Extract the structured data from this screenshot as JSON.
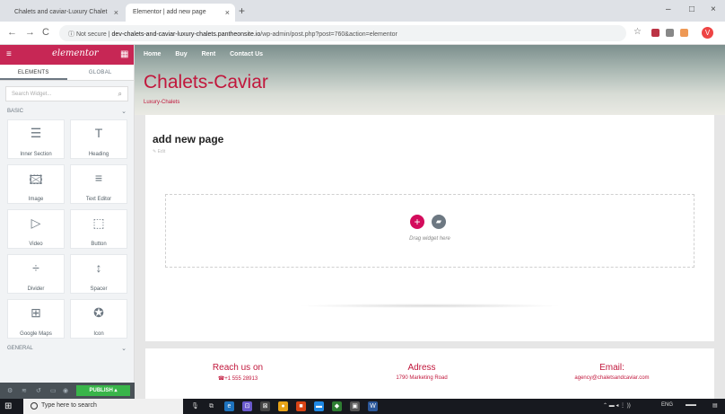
{
  "browser": {
    "tabs": [
      {
        "title": "Chalets and caviar-Luxury Chalet",
        "active": false
      },
      {
        "title": "Elementor | add new page",
        "active": true
      }
    ],
    "new_tab": "+",
    "minimize": "–",
    "maximize": "□",
    "close": "×",
    "back": "←",
    "forward": "→",
    "reload": "C",
    "security": "Not secure",
    "url_domain": "dev-chalets-and-caviar-luxury-chalets.pantheonsite.io",
    "url_path": "/wp-admin/post.php?post=760&action=elementor",
    "star": "☆",
    "profile_initial": "V"
  },
  "panel": {
    "logo": "elementor",
    "tabs": [
      "ELEMENTS",
      "GLOBAL"
    ],
    "search_placeholder": "Search Widget...",
    "category_basic": "BASIC",
    "category_general": "GENERAL",
    "widgets": [
      {
        "icon": "inner-section-icon",
        "label": "Inner Section",
        "glyph": "☰"
      },
      {
        "icon": "heading-icon",
        "label": "Heading",
        "glyph": "T"
      },
      {
        "icon": "image-icon",
        "label": "Image",
        "glyph": "🖾"
      },
      {
        "icon": "text-editor-icon",
        "label": "Text Editor",
        "glyph": "≡"
      },
      {
        "icon": "video-icon",
        "label": "Video",
        "glyph": "▷"
      },
      {
        "icon": "button-icon",
        "label": "Button",
        "glyph": "⬚"
      },
      {
        "icon": "divider-icon",
        "label": "Divider",
        "glyph": "÷"
      },
      {
        "icon": "spacer-icon",
        "label": "Spacer",
        "glyph": "↕"
      },
      {
        "icon": "google-maps-icon",
        "label": "Google Maps",
        "glyph": "⊞"
      },
      {
        "icon": "icon-widget-icon",
        "label": "Icon",
        "glyph": "✪"
      }
    ],
    "publish": "PUBLISH"
  },
  "site": {
    "menu": [
      "Home",
      "Buy",
      "Rent",
      "Contact Us"
    ],
    "title": "Chalets-Caviar",
    "tagline": "Luxury-Chalets",
    "page_title": "add new page",
    "edit_label": "Edit",
    "drag_text": "Drag widget here",
    "footer": [
      {
        "heading": "Reach us on",
        "value": "+1 555 28913"
      },
      {
        "heading": "Adress",
        "value": "1790 Marketing Road"
      },
      {
        "heading": "Email:",
        "value": "agency@chaletsandcaviar.com"
      }
    ]
  },
  "taskbar": {
    "search_placeholder": "Type here to search",
    "language": "ENG"
  },
  "colors": {
    "elementor_brand": "#c72755",
    "site_accent": "#c1173c",
    "publish_green": "#39b54a"
  }
}
